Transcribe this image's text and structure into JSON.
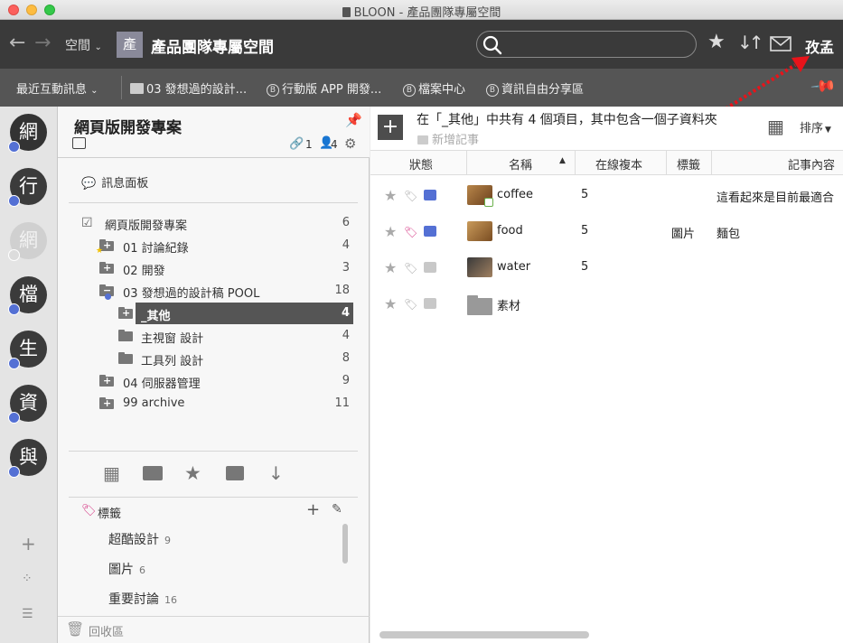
{
  "window": {
    "title": "BLOON - 產品團隊專屬空間"
  },
  "toolbar": {
    "space_menu": "空間",
    "space_badge": "產",
    "space_name": "產品團隊專屬空間",
    "search_placeholder": "",
    "user_name": "孜孟"
  },
  "bookmarks": {
    "recent": "最近互動訊息",
    "items": [
      {
        "label": "03 發想過的設計..."
      },
      {
        "label": "行動版 APP 開發..."
      },
      {
        "label": "檔案中心"
      },
      {
        "label": "資訊自由分享區"
      }
    ]
  },
  "avatars": [
    {
      "label": "網",
      "checked": true
    },
    {
      "label": "行",
      "checked": true
    },
    {
      "label": "網",
      "checked": true,
      "faded": true
    },
    {
      "label": "檔",
      "checked": true
    },
    {
      "label": "生",
      "checked": true
    },
    {
      "label": "資",
      "checked": true
    },
    {
      "label": "與",
      "checked": false
    }
  ],
  "project": {
    "title": "網頁版開發專案",
    "links": "1",
    "members": "4",
    "message_board": "訊息面板"
  },
  "tree": [
    {
      "label": "網頁版開發專案",
      "count": "6"
    },
    {
      "label": "01 討論紀錄",
      "count": "4"
    },
    {
      "label": "02 開發",
      "count": "3"
    },
    {
      "label": "03 發想過的設計稿 POOL",
      "count": "18"
    },
    {
      "label": "_其他",
      "count": "4"
    },
    {
      "label": "主視窗 設計",
      "count": "4"
    },
    {
      "label": "工具列 設計",
      "count": "8"
    },
    {
      "label": "04 伺服器管理",
      "count": "9"
    },
    {
      "label": "99 archive",
      "count": "11"
    }
  ],
  "tags": {
    "header": "標籤",
    "items": [
      {
        "label": "超酷設計",
        "count": "9"
      },
      {
        "label": "圖片",
        "count": "6"
      },
      {
        "label": "重要討論",
        "count": "16"
      }
    ]
  },
  "trash": "回收區",
  "content": {
    "summary": "在「_其他」中共有 4 個項目，其中包含一個子資料夾",
    "new_note": "新增記事",
    "sort": "排序",
    "columns": [
      "狀態",
      "名稱",
      "在線複本",
      "標籤",
      "記事內容"
    ],
    "rows": [
      {
        "name": "coffee",
        "copies": "5",
        "tag": "",
        "note": "這看起來是目前最適合"
      },
      {
        "name": "food",
        "copies": "5",
        "tag": "圖片",
        "note": "麵包"
      },
      {
        "name": "water",
        "copies": "5",
        "tag": "",
        "note": ""
      },
      {
        "name": "素材",
        "copies": "",
        "tag": "",
        "note": ""
      }
    ]
  },
  "colors": {
    "accent_blue": "#5470d4",
    "tag_pink": "#d63b86",
    "link_green": "#6ab04c",
    "annotation_red": "#e8131a"
  }
}
